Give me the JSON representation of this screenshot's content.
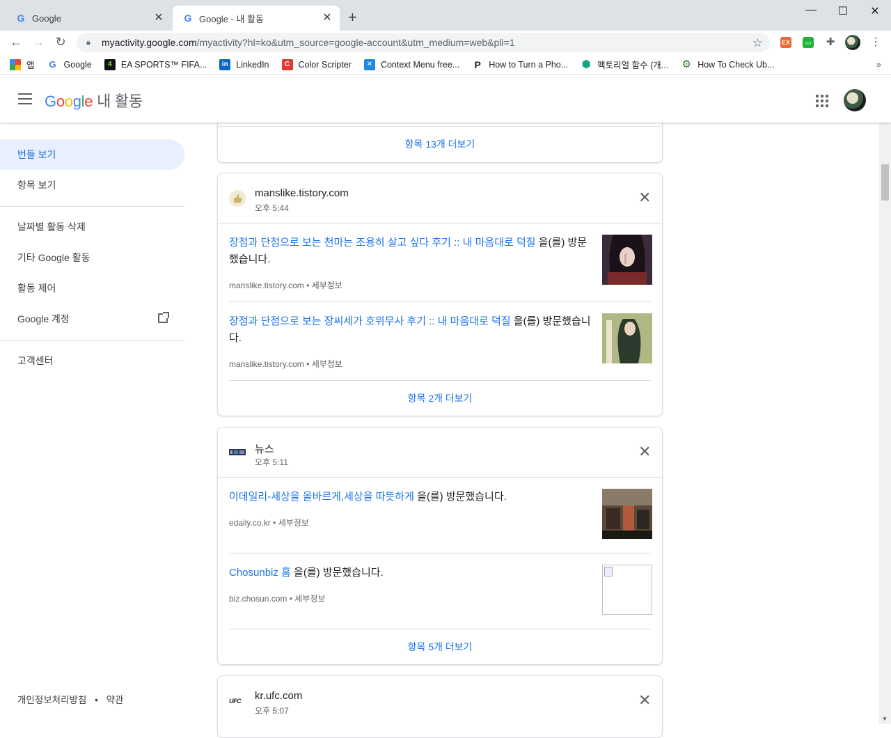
{
  "browser": {
    "tabs": [
      {
        "title": "Google"
      },
      {
        "title": "Google - 내 활동"
      }
    ],
    "url_host": "myactivity.google.com",
    "url_path": "/myactivity?hl=ko&utm_source=google-account&utm_medium=web&pli=1",
    "bookmarks": [
      {
        "label": "앱",
        "icon": "apps-grid-icon"
      },
      {
        "label": "Google",
        "icon": "google-icon"
      },
      {
        "label": "EA SPORTS™ FIFA...",
        "icon": "ea-sports-icon"
      },
      {
        "label": "LinkedIn",
        "icon": "linkedin-icon"
      },
      {
        "label": "Color Scripter",
        "icon": "color-scripter-icon"
      },
      {
        "label": "Context Menu free...",
        "icon": "context-menu-icon"
      },
      {
        "label": "How to Turn a Pho...",
        "icon": "p-icon"
      },
      {
        "label": "팩토리얼 함수 (개...",
        "icon": "hexagon-icon"
      },
      {
        "label": "How To Check Ub...",
        "icon": "gear-icon"
      }
    ]
  },
  "header": {
    "logo": "Google",
    "product": "내 활동"
  },
  "sidebar": {
    "items": [
      {
        "label": "번들 보기",
        "selected": true
      },
      {
        "label": "항목 보기"
      },
      {
        "label": "날짜별 활동 삭제"
      },
      {
        "label": "기타 Google 활동"
      },
      {
        "label": "활동 제어"
      },
      {
        "label": "Google 계정"
      },
      {
        "label": "고객센터"
      }
    ],
    "footer_privacy": "개인정보처리방침",
    "footer_sep": "•",
    "footer_terms": "약관"
  },
  "cards": [
    {
      "more_label": "항목 13개 더보기"
    },
    {
      "site": "manslike.tistory.com",
      "time": "오후 5:44",
      "items": [
        {
          "link": "장점과 단점으로 보는 천마는 조용히 살고 싶다 후기 :: 내 마음대로 덕질",
          "suffix": " 을(를) 방문했습니다.",
          "domain": "manslike.tistory.com",
          "details": "세부정보"
        },
        {
          "link": "장점과 단점으로 보는 장씨세가 호위무사 후기 :: 내 마음대로 덕질",
          "suffix": " 을(를) 방문했습니다.",
          "domain": "manslike.tistory.com",
          "details": "세부정보"
        }
      ],
      "more_label": "항목 2개 더보기"
    },
    {
      "site": "뉴스",
      "time": "오후 5:11",
      "items": [
        {
          "link": "이데일리-세상을 올바르게,세상을 따뜻하게",
          "suffix": " 을(를) 방문했습니다.",
          "domain": "edaily.co.kr",
          "details": "세부정보"
        },
        {
          "link": "Chosunbiz 홈",
          "suffix": " 을(를) 방문했습니다.",
          "domain": "biz.chosun.com",
          "details": "세부정보"
        }
      ],
      "more_label": "항목 5개 더보기"
    },
    {
      "site": "kr.ufc.com",
      "time": "오후 5:07"
    }
  ],
  "colors": {
    "link": "#1a73e8",
    "selected_bg": "#e8f0fe"
  }
}
